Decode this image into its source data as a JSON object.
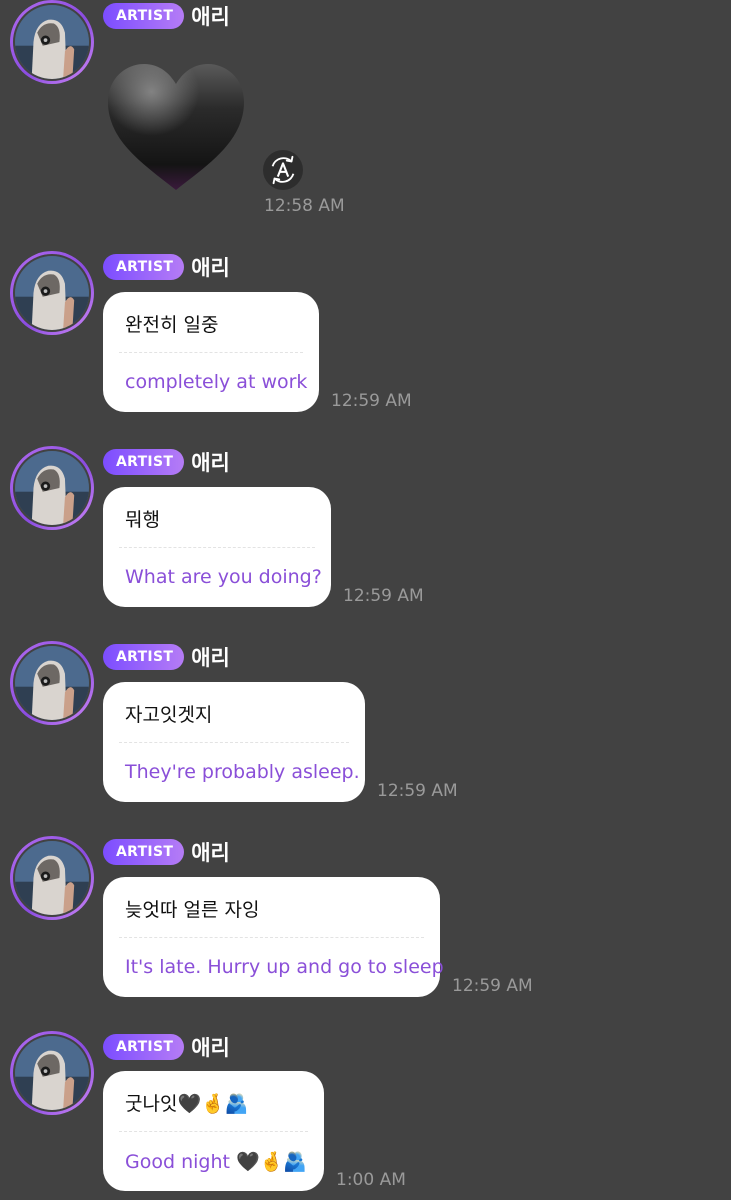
{
  "colors": {
    "background": "#424242",
    "bubble": "#ffffff",
    "translation_text": "#8a4fd8",
    "badge_gradient_start": "#7c4dff",
    "badge_gradient_end": "#b57cf6",
    "timestamp": "#9a9a9a"
  },
  "messages": [
    {
      "badge": "ARTIST",
      "name": "애리",
      "type": "sticker",
      "sticker_icon": "black-heart-icon",
      "translate_icon": "auto-translate-icon",
      "time": "12:58 AM"
    },
    {
      "badge": "ARTIST",
      "name": "애리",
      "type": "text",
      "original": "완전히 일중",
      "translation": "completely at work",
      "time": "12:59 AM"
    },
    {
      "badge": "ARTIST",
      "name": "애리",
      "type": "text",
      "original": "뭐행",
      "translation": "What are you doing?",
      "time": "12:59 AM"
    },
    {
      "badge": "ARTIST",
      "name": "애리",
      "type": "text",
      "original": "자고잇겟지",
      "translation": "They're probably asleep.",
      "time": "12:59 AM"
    },
    {
      "badge": "ARTIST",
      "name": "애리",
      "type": "text",
      "original": "늦엇따 얼른 자잉",
      "translation": "It's late. Hurry up and go to sleep",
      "time": "12:59 AM"
    },
    {
      "badge": "ARTIST",
      "name": "애리",
      "type": "text",
      "original": "굿나잇🖤🤞🫂",
      "translation": "Good night 🖤🤞🫂",
      "time": "1:00 AM"
    }
  ]
}
